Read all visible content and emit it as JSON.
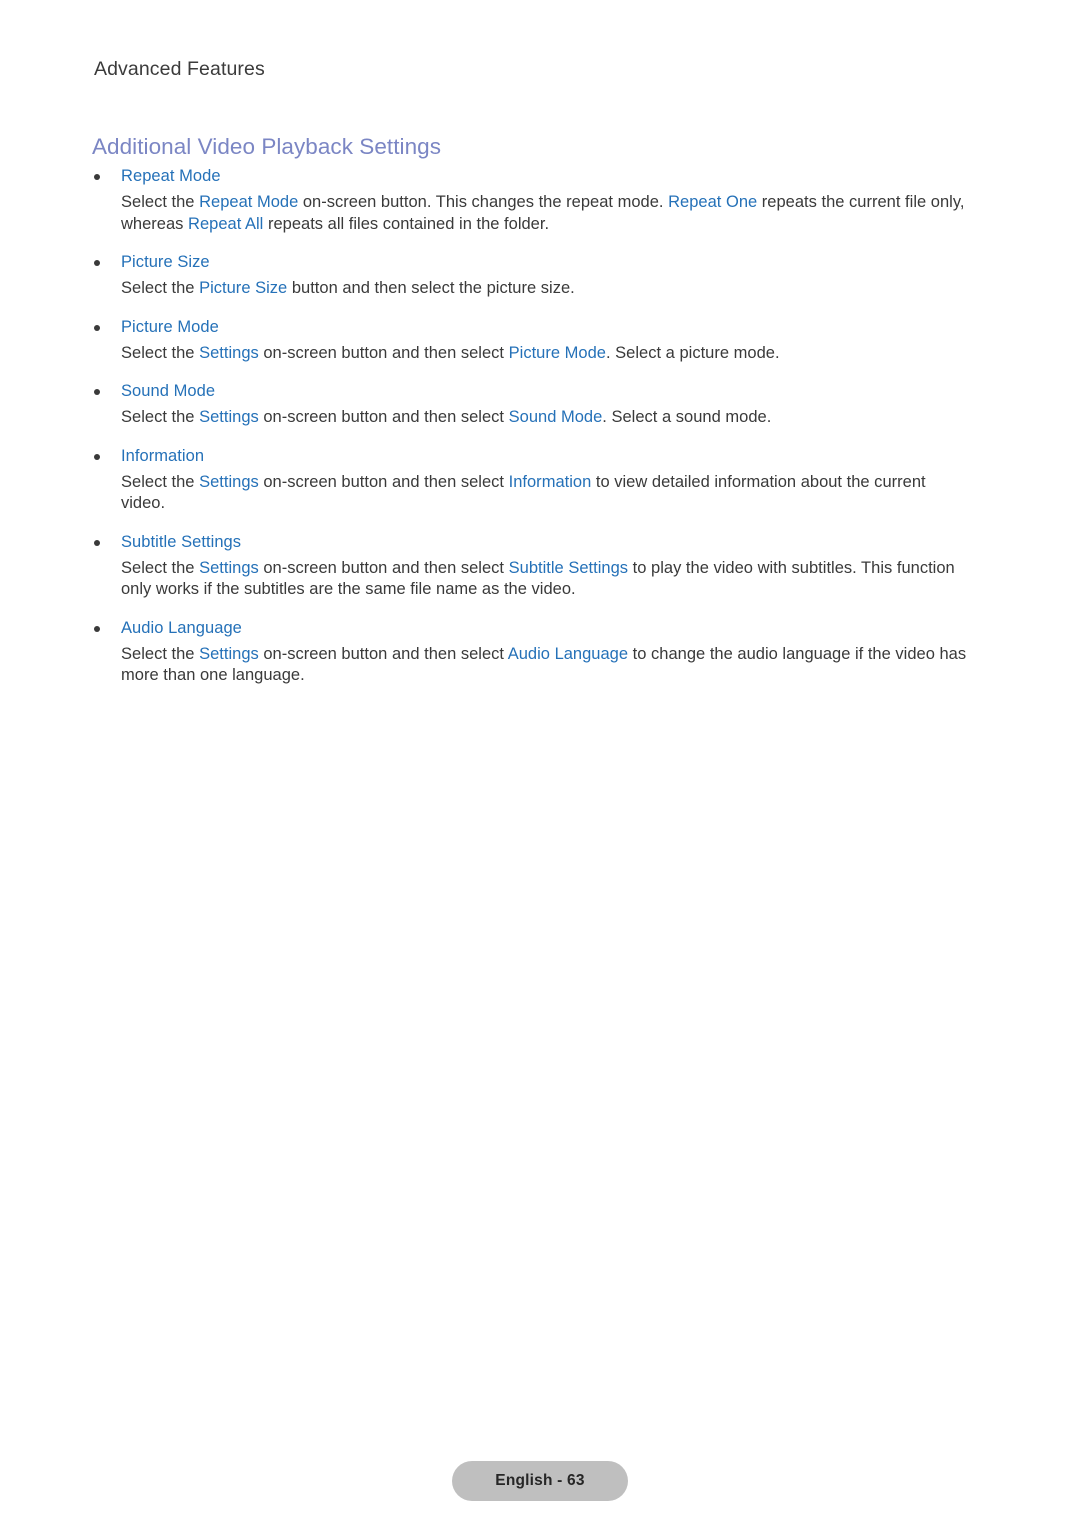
{
  "page": {
    "running_head": "Advanced Features",
    "section_heading": "Additional Video Playback Settings",
    "footer_badge": "English - 63",
    "colors": {
      "link_blue": "#2571b8",
      "heading_purple": "#7b86c4",
      "body_text": "#3a3a3a",
      "badge_gray": "#bfbfbf"
    }
  },
  "items": [
    {
      "label": "Repeat Mode",
      "body": [
        {
          "t": "Select the ",
          "kw": false
        },
        {
          "t": "Repeat Mode",
          "kw": true
        },
        {
          "t": " on-screen button. This changes the repeat mode. ",
          "kw": false
        },
        {
          "t": "Repeat One",
          "kw": true
        },
        {
          "t": " repeats the current file only, whereas ",
          "kw": false
        },
        {
          "t": "Repeat All",
          "kw": true
        },
        {
          "t": " repeats all files contained in the folder.",
          "kw": false
        }
      ]
    },
    {
      "label": "Picture Size",
      "body": [
        {
          "t": "Select the ",
          "kw": false
        },
        {
          "t": "Picture Size",
          "kw": true
        },
        {
          "t": " button and then select the picture size.",
          "kw": false
        }
      ]
    },
    {
      "label": "Picture Mode",
      "body": [
        {
          "t": "Select the ",
          "kw": false
        },
        {
          "t": "Settings",
          "kw": true
        },
        {
          "t": " on-screen button and then select ",
          "kw": false
        },
        {
          "t": "Picture Mode",
          "kw": true
        },
        {
          "t": ". Select a picture mode.",
          "kw": false
        }
      ]
    },
    {
      "label": "Sound Mode",
      "body": [
        {
          "t": "Select the ",
          "kw": false
        },
        {
          "t": "Settings",
          "kw": true
        },
        {
          "t": " on-screen button and then select ",
          "kw": false
        },
        {
          "t": "Sound Mode",
          "kw": true
        },
        {
          "t": ". Select a sound mode.",
          "kw": false
        }
      ]
    },
    {
      "label": "Information",
      "body": [
        {
          "t": "Select the ",
          "kw": false
        },
        {
          "t": "Settings",
          "kw": true
        },
        {
          "t": " on-screen button and then select ",
          "kw": false
        },
        {
          "t": "Information",
          "kw": true
        },
        {
          "t": " to view detailed information about the current video.",
          "kw": false
        }
      ]
    },
    {
      "label": "Subtitle Settings",
      "body": [
        {
          "t": "Select the ",
          "kw": false
        },
        {
          "t": "Settings",
          "kw": true
        },
        {
          "t": " on-screen button and then select ",
          "kw": false
        },
        {
          "t": "Subtitle Settings",
          "kw": true
        },
        {
          "t": " to play the video with subtitles. This function only works if the subtitles are the same file name as the video.",
          "kw": false
        }
      ]
    },
    {
      "label": "Audio Language",
      "body": [
        {
          "t": "Select the ",
          "kw": false
        },
        {
          "t": "Settings",
          "kw": true
        },
        {
          "t": " on-screen button and then select ",
          "kw": false
        },
        {
          "t": "Audio Language",
          "kw": true
        },
        {
          "t": " to change the audio language if the video has more than one language.",
          "kw": false
        }
      ]
    }
  ]
}
